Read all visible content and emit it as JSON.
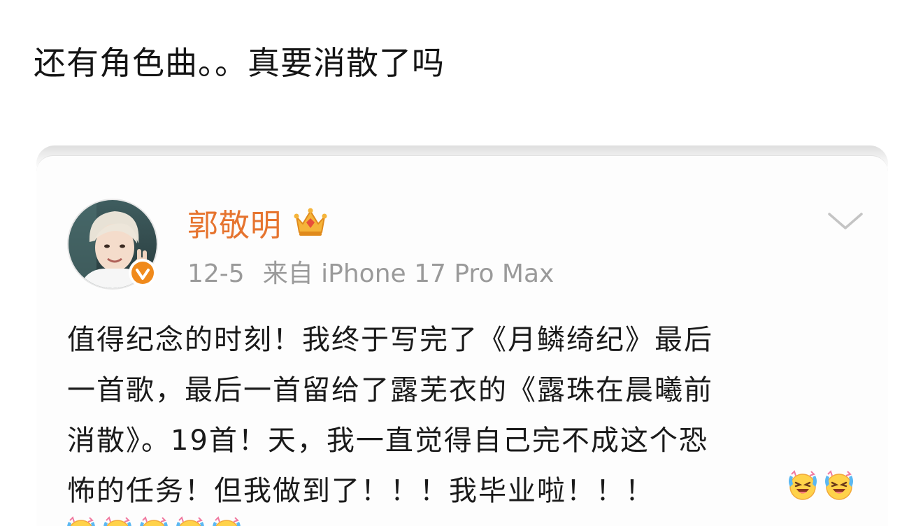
{
  "caption": "还有角色曲。。真要消散了吗",
  "post": {
    "author": {
      "name": "郭敬明",
      "avatar_icon": "profile-photo",
      "verified_icon": "verified-badge-icon",
      "member_icon": "crown-icon"
    },
    "meta": {
      "date": "12-5",
      "source": "来自 iPhone 17 Pro Max"
    },
    "menu_icon": "chevron-down-icon",
    "text_lines": [
      "值得纪念的时刻！我终于写完了《月鳞绮纪》最后",
      "一首歌，最后一首留给了露芜衣的《露珠在晨曦前",
      "消散》。19首！天，我一直觉得自己完不成这个恐",
      "怖的任务！但我做到了！！！我毕业啦！！！"
    ],
    "emoji_icon": "laughing-crying-emoji",
    "emoji_count_line1": 2,
    "emoji_count_line2": 5
  },
  "colors": {
    "author_name": "#e6742f",
    "meta_text": "#9a9a9a",
    "body_text": "#1a1a1a",
    "verified_badge": "#f08a1c"
  }
}
